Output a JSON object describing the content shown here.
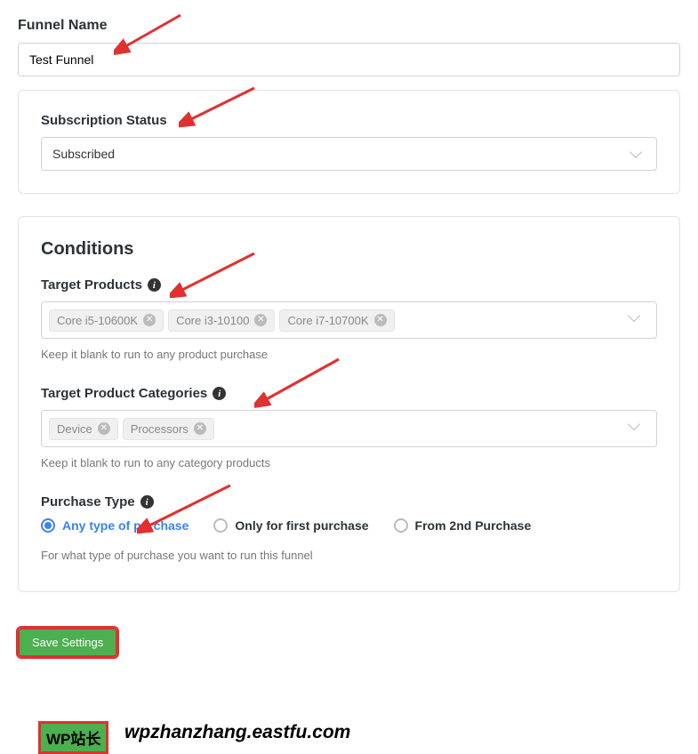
{
  "funnelName": {
    "label": "Funnel Name",
    "value": "Test Funnel"
  },
  "subStatusSection": {
    "label": "Subscription Status",
    "selected": "Subscribed"
  },
  "conditions": {
    "heading": "Conditions",
    "targetProducts": {
      "label": "Target Products",
      "tags": [
        "Core i5-10600K",
        "Core i3-10100",
        "Core i7-10700K"
      ],
      "hint": "Keep it blank to run to any product purchase"
    },
    "targetCategories": {
      "label": "Target Product Categories",
      "tags": [
        "Device",
        "Processors"
      ],
      "hint": "Keep it blank to run to any category products"
    },
    "purchaseType": {
      "label": "Purchase Type",
      "options": [
        {
          "label": "Any type of purchase",
          "selected": true
        },
        {
          "label": "Only for first purchase",
          "selected": false
        },
        {
          "label": "From 2nd Purchase",
          "selected": false
        }
      ],
      "hint": "For what type of purchase you want to run this funnel"
    }
  },
  "save": {
    "label": "Save Settings"
  },
  "watermark": {
    "badge": "WP站长",
    "url": "wpzhanzhang.eastfu.com"
  }
}
